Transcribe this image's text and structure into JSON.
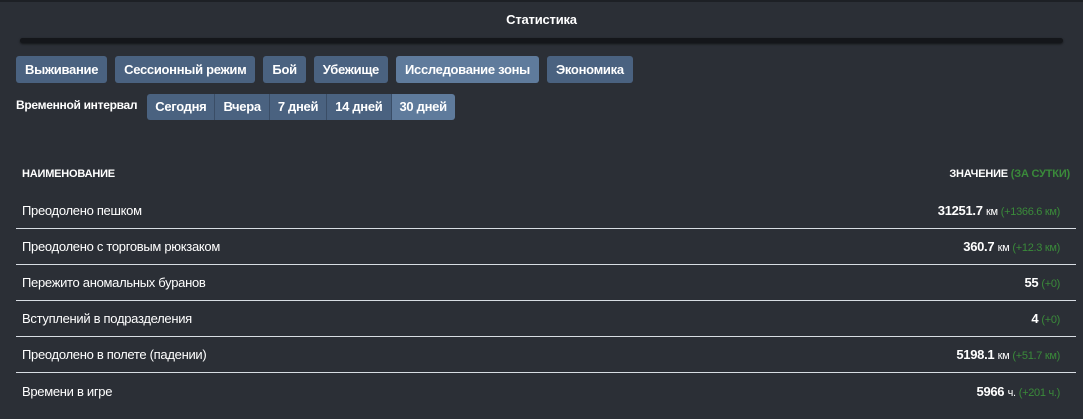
{
  "window": {
    "title": "Статистика"
  },
  "tabs": [
    {
      "label": "Выживание",
      "active": false
    },
    {
      "label": "Сессионный режим",
      "active": false
    },
    {
      "label": "Бой",
      "active": false
    },
    {
      "label": "Убежище",
      "active": false
    },
    {
      "label": "Исследование зоны",
      "active": true
    },
    {
      "label": "Экономика",
      "active": false
    }
  ],
  "interval": {
    "label": "Временной интервал",
    "options": [
      {
        "label": "Сегодня",
        "active": false
      },
      {
        "label": "Вчера",
        "active": false
      },
      {
        "label": "7 дней",
        "active": false
      },
      {
        "label": "14 дней",
        "active": false
      },
      {
        "label": "30 дней",
        "active": true
      }
    ]
  },
  "table": {
    "header": {
      "name": "НАИМЕНОВАНИЕ",
      "value": "ЗНАЧЕНИЕ",
      "value_suffix": "(ЗА СУТКИ)"
    },
    "rows": [
      {
        "name": "Преодолено пешком",
        "value": "31251.7",
        "unit": "км",
        "delta": "(+1366.6 км)"
      },
      {
        "name": "Преодолено с торговым рюкзаком",
        "value": "360.7",
        "unit": "км",
        "delta": "(+12.3 км)"
      },
      {
        "name": "Пережито аномальных буранов",
        "value": "55",
        "unit": "",
        "delta": "(+0)"
      },
      {
        "name": "Вступлений в подразделения",
        "value": "4",
        "unit": "",
        "delta": "(+0)"
      },
      {
        "name": "Преодолено в полете (падении)",
        "value": "5198.1",
        "unit": "км",
        "delta": "(+51.7 км)"
      },
      {
        "name": "Времени в игре",
        "value": "5966",
        "unit": "ч.",
        "delta": "(+201 ч.)"
      }
    ]
  },
  "colors": {
    "background": "#2b2f36",
    "tab": "#4a6280",
    "tab_active": "#5f7b9c",
    "delta_green": "#3a8a3a"
  }
}
